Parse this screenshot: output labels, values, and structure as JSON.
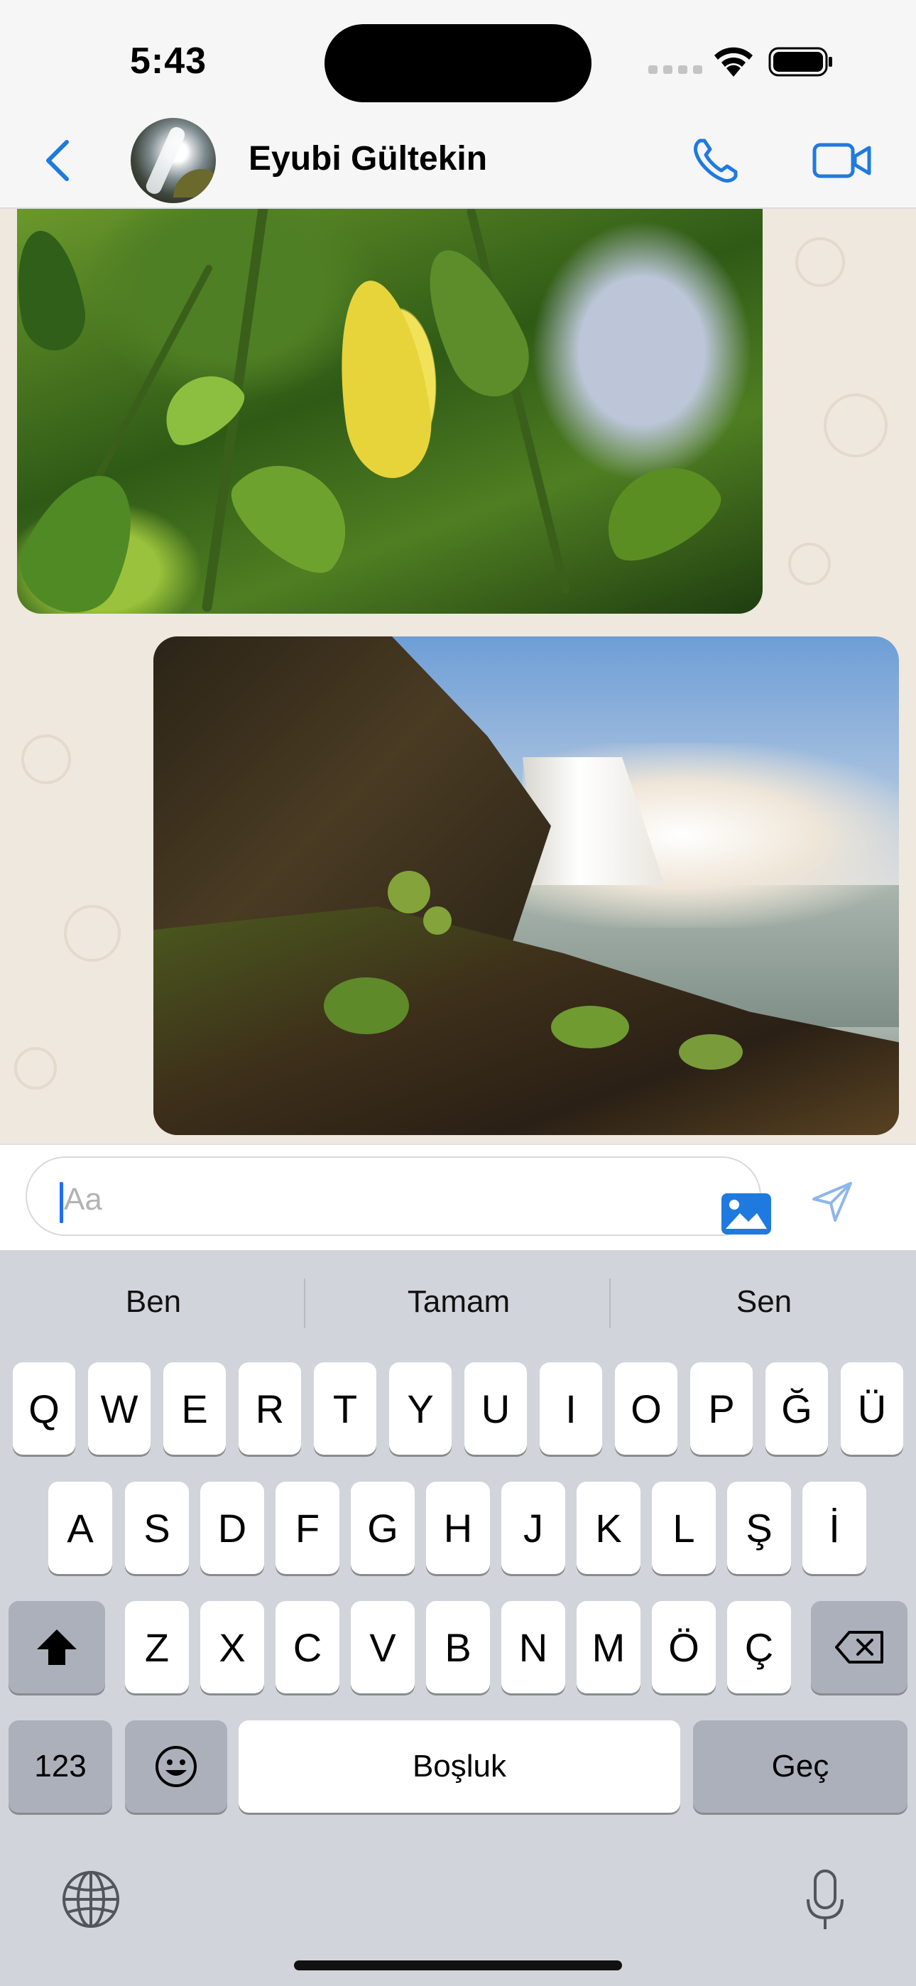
{
  "status_bar": {
    "time": "5:43"
  },
  "header": {
    "contact_name": "Eyubi Gültekin",
    "icons": [
      "back-chevron-icon",
      "avatar",
      "phone-icon",
      "video-camera-icon"
    ],
    "accent": "#1f7ae0"
  },
  "chat": {
    "messages": [
      {
        "type": "image",
        "description_icon": "plant-leaves-photo"
      },
      {
        "type": "image",
        "description_icon": "waterfall-photo"
      }
    ],
    "background": "#efe8df"
  },
  "composer": {
    "placeholder": "Aa",
    "icons": [
      "image-icon",
      "send-icon"
    ]
  },
  "keyboard": {
    "suggestions": [
      "Ben",
      "Tamam",
      "Sen"
    ],
    "row1": [
      "Q",
      "W",
      "E",
      "R",
      "T",
      "Y",
      "U",
      "I",
      "O",
      "P",
      "Ğ",
      "Ü"
    ],
    "row2": [
      "A",
      "S",
      "D",
      "F",
      "G",
      "H",
      "J",
      "K",
      "L",
      "Ş",
      "İ"
    ],
    "row3": [
      "Z",
      "X",
      "C",
      "V",
      "B",
      "N",
      "M",
      "Ö",
      "Ç"
    ],
    "numbers_label": "123",
    "space_label": "Boşluk",
    "return_label": "Geç"
  }
}
